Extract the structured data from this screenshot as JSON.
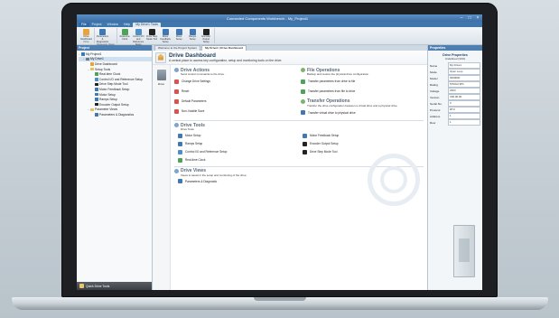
{
  "window": {
    "title": "Connected Components Workbench - My_Project1"
  },
  "ribbon_tabs": [
    "File",
    "Project",
    "Window",
    "Help",
    "My Drive1 Tools"
  ],
  "ribbon": {
    "groups": [
      {
        "name": "Drive",
        "buttons": [
          {
            "label": "Drive Dashboard",
            "icon": "home-icon",
            "color": "#e8a33b"
          }
        ]
      },
      {
        "name": "Parameter Views",
        "buttons": [
          {
            "label": "Parameters & Diagnostics",
            "icon": "parameters-icon",
            "color": "#3f78b5"
          }
        ]
      },
      {
        "name": "Setup Tools",
        "buttons": [
          {
            "label": "Real-time Clock",
            "icon": "clock-icon",
            "color": "#4fa25a"
          },
          {
            "label": "Control I/O and Reference Setup",
            "icon": "io-icon",
            "color": "#4f8fc8"
          },
          {
            "label": "Drive Step Mode Tool",
            "icon": "step-icon",
            "color": "#222222"
          },
          {
            "label": "Motor Feedback Setup",
            "icon": "feedback-icon",
            "color": "#3f78b5"
          },
          {
            "label": "Motor Setup",
            "icon": "motor-icon",
            "color": "#3f78b5"
          },
          {
            "label": "Ramps Setup",
            "icon": "ramp-icon",
            "color": "#3f78b5"
          },
          {
            "label": "Encoder Output Setup",
            "icon": "encoder-icon",
            "color": "#222222"
          }
        ]
      }
    ]
  },
  "project_panel": {
    "title": "Project",
    "tree": [
      {
        "label": "My Project1",
        "level": 0,
        "expander": "−",
        "color": "#3f78b5"
      },
      {
        "label": "My Drive1",
        "level": 1,
        "expander": "−",
        "color": "#6e7b88",
        "selected": true
      },
      {
        "label": "Drive Dashboard",
        "level": 2,
        "expander": "",
        "color": "#e8a33b"
      },
      {
        "label": "Setup Tools",
        "level": 2,
        "expander": "−",
        "color": "#e3c25a"
      },
      {
        "label": "Real-time Clock",
        "level": 3,
        "expander": "",
        "color": "#4fa25a"
      },
      {
        "label": "Control I/O and Reference Setup",
        "level": 3,
        "expander": "",
        "color": "#4f8fc8"
      },
      {
        "label": "Drive Step Mode Tool",
        "level": 3,
        "expander": "",
        "color": "#222222"
      },
      {
        "label": "Motor Feedback Setup",
        "level": 3,
        "expander": "",
        "color": "#3f78b5"
      },
      {
        "label": "Motor Setup",
        "level": 3,
        "expander": "",
        "color": "#3f78b5"
      },
      {
        "label": "Ramps Setup",
        "level": 3,
        "expander": "",
        "color": "#3f78b5"
      },
      {
        "label": "Encoder Output Setup",
        "level": 3,
        "expander": "",
        "color": "#222222"
      },
      {
        "label": "Parameter Views",
        "level": 2,
        "expander": "−",
        "color": "#e3c25a"
      },
      {
        "label": "Parameters & Diagnostics",
        "level": 3,
        "expander": "",
        "color": "#3f78b5"
      }
    ],
    "quick": "Quick Drive Tools"
  },
  "doc_tabs": [
    {
      "label": "Welcome to the Project System",
      "active": false
    },
    {
      "label": "My Drive1 | Drive Dashboard",
      "active": true
    }
  ],
  "dashboard": {
    "title": "Drive Dashboard",
    "subtitle": "A central place to access key configuration, setup and monitoring tools on the drive.",
    "side_label": "Drive",
    "drive_actions": {
      "title": "Drive Actions",
      "desc": "Send control commands to the drive.",
      "items": [
        {
          "label": "Change Drive Settings",
          "color": "#d9534f"
        },
        {
          "label": "Reset",
          "color": "#d9534f"
        },
        {
          "label": "Default Parameters",
          "color": "#d9534f"
        },
        {
          "label": "Non-Volatile Save",
          "color": "#d9534f"
        }
      ]
    },
    "file_operations": {
      "title": "File Operations",
      "desc": "Backup and restore the physical drive configuration.",
      "items": [
        {
          "label": "Transfer parameters from drive to file",
          "color": "#4fa25a"
        },
        {
          "label": "Transfer parameters from file to drive",
          "color": "#4fa25a"
        }
      ]
    },
    "transfer_operations": {
      "title": "Transfer Operations",
      "desc": "Transfer the drive configuration between a virtual drive and a physical drive.",
      "items": [
        {
          "label": "Transfer virtual drive to physical drive",
          "color": "#3f78b5"
        }
      ]
    },
    "drive_tools": {
      "title": "Drive Tools",
      "desc": "Drive Tools",
      "items": [
        {
          "label": "Motor Setup",
          "color": "#3f78b5"
        },
        {
          "label": "Motor Feedback Setup",
          "color": "#3f78b5"
        },
        {
          "label": "Ramps Setup",
          "color": "#3f78b5"
        },
        {
          "label": "Encoder Output Setup",
          "color": "#222222"
        },
        {
          "label": "Control I/O and Reference Setup",
          "color": "#4f8fc8"
        },
        {
          "label": "Drive Step Mode Tool",
          "color": "#222222"
        },
        {
          "label": "Real-time Clock",
          "color": "#4fa25a"
        }
      ]
    },
    "drive_views": {
      "title": "Drive Views",
      "desc": "Views to assist in the setup and monitoring of the drive.",
      "items": [
        {
          "label": "Parameters & Diagnostic",
          "color": "#3f78b5"
        }
      ]
    }
  },
  "properties": {
    "panel_title": "Properties",
    "title": "Drive Properties",
    "subtitle": "Undefined (VFD)",
    "rows": [
      {
        "key": "Name",
        "value": "My Drive1"
      },
      {
        "key": "Mode",
        "value": "Open Loop"
      },
      {
        "key": "Model",
        "value": "0000000"
      },
      {
        "key": "Rating",
        "value": "575Volt 3Ph"
      },
      {
        "key": "Voltage",
        "value": "230V"
      },
      {
        "key": "Version",
        "value": "V00.00.00"
      },
      {
        "key": "Serial No.",
        "value": "0"
      },
      {
        "key": "Protocol",
        "value": "RTU"
      },
      {
        "key": "Address",
        "value": "1"
      },
      {
        "key": "Row",
        "value": "1"
      }
    ]
  }
}
